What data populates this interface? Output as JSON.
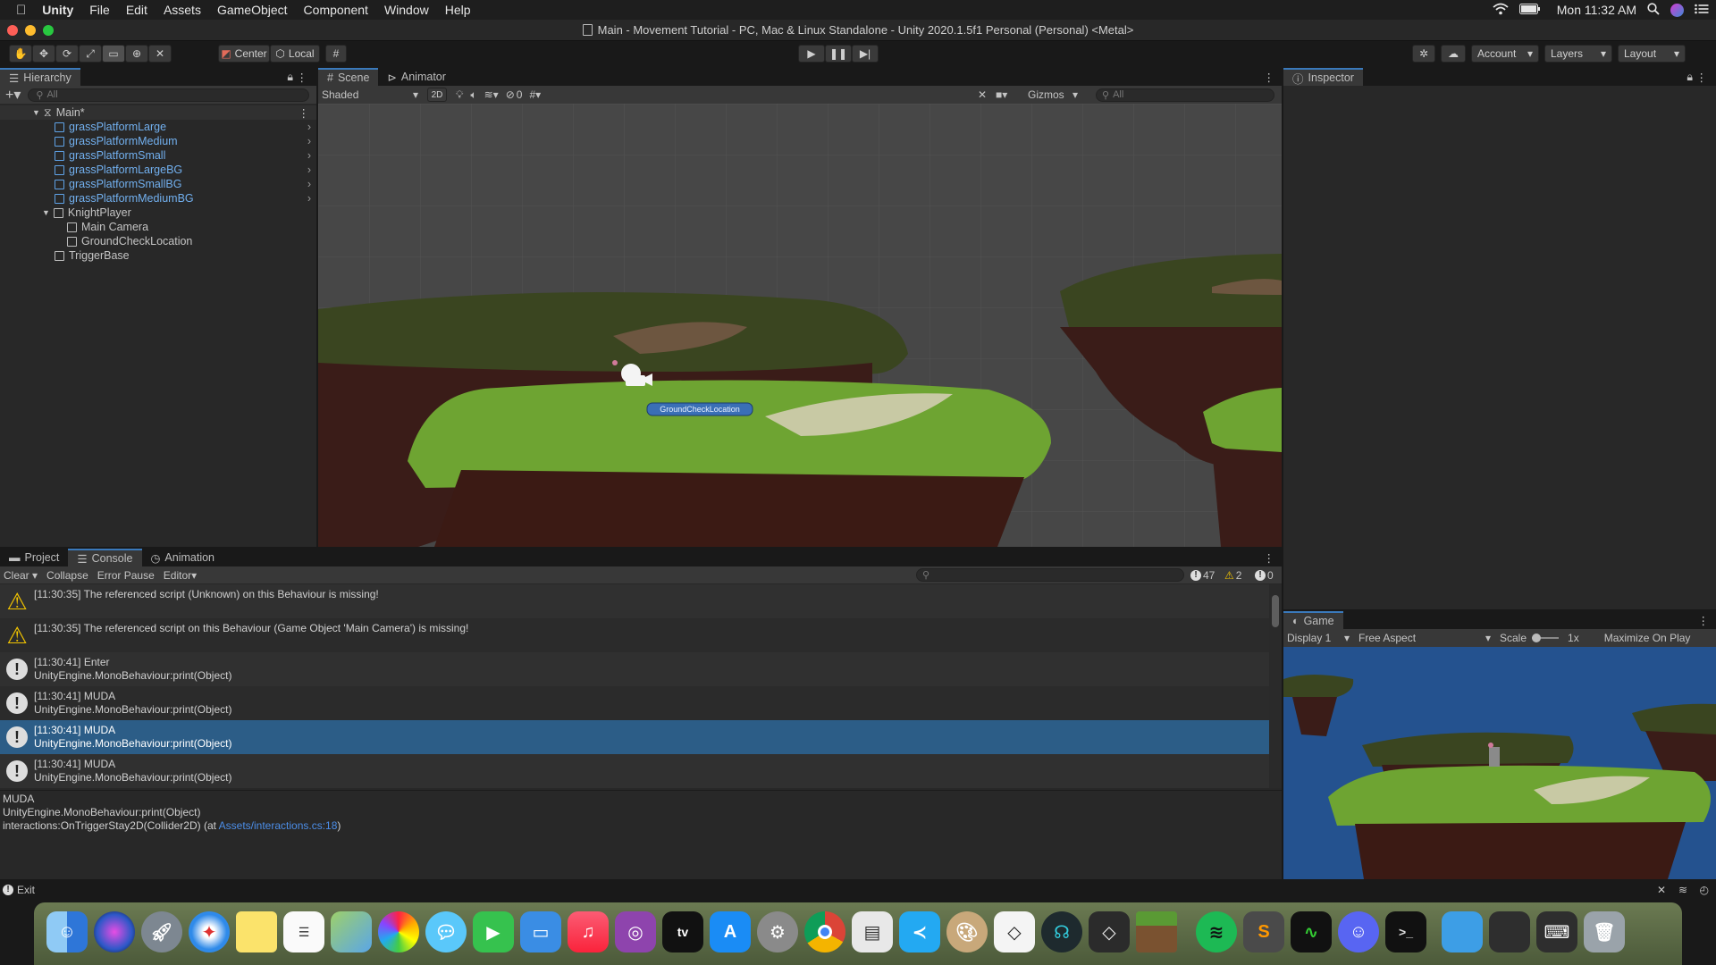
{
  "menubar": {
    "app": "Unity",
    "items": [
      "File",
      "Edit",
      "Assets",
      "GameObject",
      "Component",
      "Window",
      "Help"
    ],
    "clock": "Mon 11:32 AM"
  },
  "window": {
    "title": "Main - Movement Tutorial - PC, Mac & Linux Standalone - Unity 2020.1.5f1 Personal (Personal) <Metal>"
  },
  "toolbar": {
    "pivot": "Center",
    "space": "Local",
    "account": "Account",
    "layers": "Layers",
    "layout": "Layout"
  },
  "hierarchy": {
    "tab": "Hierarchy",
    "search_placeholder": "All",
    "scene": "Main*",
    "items": [
      {
        "label": "grassPlatformLarge"
      },
      {
        "label": "grassPlatformMedium"
      },
      {
        "label": "grassPlatformSmall"
      },
      {
        "label": "grassPlatformLargeBG"
      },
      {
        "label": "grassPlatformSmallBG"
      },
      {
        "label": "grassPlatformMediumBG"
      },
      {
        "label": "KnightPlayer"
      },
      {
        "label": "Main Camera"
      },
      {
        "label": "GroundCheckLocation"
      },
      {
        "label": "TriggerBase"
      }
    ]
  },
  "scene": {
    "tabs": [
      "Scene",
      "Animator"
    ],
    "shading": "Shaded",
    "mode2d": "2D",
    "hidden_count": "0",
    "gizmos": "Gizmos",
    "search_placeholder": "All",
    "object_label": "GroundCheckLocation"
  },
  "inspector": {
    "tab": "Inspector"
  },
  "console": {
    "tabs": [
      "Project",
      "Console",
      "Animation"
    ],
    "toolbar": [
      "Clear",
      "Collapse",
      "Error Pause",
      "Editor"
    ],
    "counts": {
      "log": "47",
      "warn": "2",
      "error": "0"
    },
    "entries": [
      {
        "type": "warn",
        "line1": "[11:30:35] The referenced script (Unknown) on this Behaviour is missing!",
        "line2": ""
      },
      {
        "type": "warn",
        "line1": "[11:30:35] The referenced script on this Behaviour (Game Object 'Main Camera') is missing!",
        "line2": ""
      },
      {
        "type": "log",
        "line1": "[11:30:41] Enter",
        "line2": "UnityEngine.MonoBehaviour:print(Object)"
      },
      {
        "type": "log",
        "line1": "[11:30:41] MUDA",
        "line2": "UnityEngine.MonoBehaviour:print(Object)"
      },
      {
        "type": "log",
        "line1": "[11:30:41] MUDA",
        "line2": "UnityEngine.MonoBehaviour:print(Object)"
      },
      {
        "type": "log",
        "line1": "[11:30:41] MUDA",
        "line2": "UnityEngine.MonoBehaviour:print(Object)"
      }
    ],
    "detail": {
      "line1": "MUDA",
      "line2": "UnityEngine.MonoBehaviour:print(Object)",
      "line3": "interactions:OnTriggerStay2D(Collider2D) (at ",
      "link": "Assets/interactions.cs:18",
      "close": ")"
    }
  },
  "game": {
    "tab": "Game",
    "display": "Display 1",
    "aspect": "Free Aspect",
    "scale_label": "Scale",
    "scale_value": "1x",
    "maximize": "Maximize On Play"
  },
  "statusbar": {
    "text": "Exit"
  },
  "dock": {
    "icons": [
      "finder-icon",
      "siri-icon",
      "launchpad-icon",
      "safari-icon",
      "notes-icon",
      "reminders-icon",
      "maps-icon",
      "photos-icon",
      "messages-icon",
      "facetime-icon",
      "keynote-icon",
      "music-icon",
      "podcasts-icon",
      "appletv-icon",
      "appstore-icon",
      "systempreferences-icon",
      "chrome-icon",
      "preview-icon",
      "vscode-icon",
      "paintbrush-icon",
      "unity-icon",
      "gitkraken-icon",
      "unityhub-icon",
      "minecraft-icon",
      "spotify-icon",
      "sublime-icon",
      "activitymonitor-icon",
      "discord-icon",
      "terminal-icon",
      "folder-icon",
      "screenshot-icon",
      "keyboard-icon",
      "trash-icon"
    ],
    "tv_label": "tv"
  }
}
